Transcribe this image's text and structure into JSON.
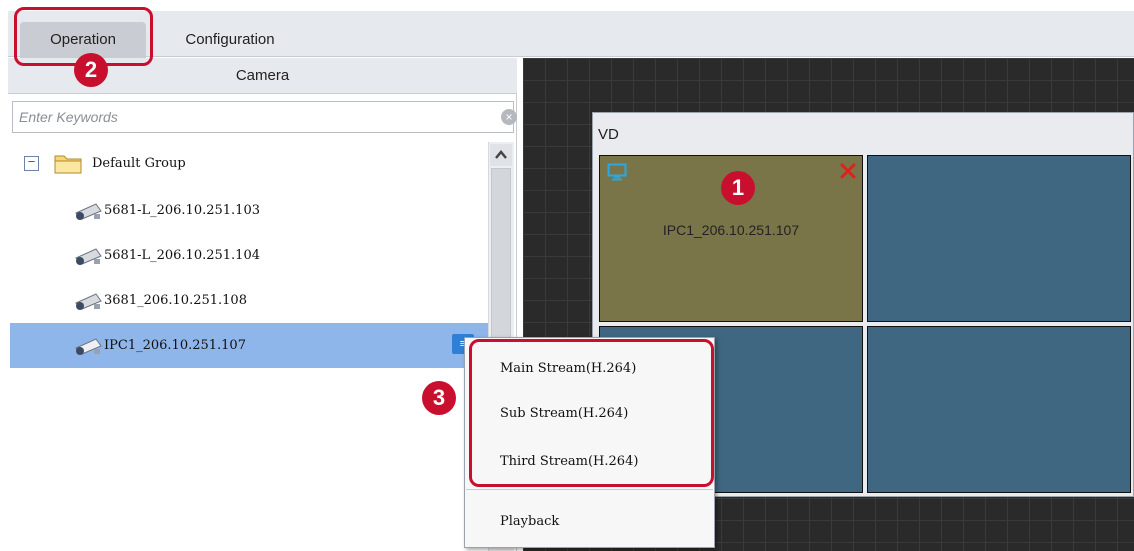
{
  "tabs": {
    "operation_label": "Operation",
    "configuration_label": "Configuration"
  },
  "camera_panel": {
    "header": "Camera",
    "search": {
      "placeholder": "Enter Keywords",
      "value": ""
    },
    "group": {
      "label": "Default Group",
      "expanded": true
    },
    "cameras": [
      {
        "label": "5681-L_206.10.251.103",
        "selected": false
      },
      {
        "label": "5681-L_206.10.251.104",
        "selected": false
      },
      {
        "label": "3681_206.10.251.108",
        "selected": false
      },
      {
        "label": "IPC1_206.10.251.107",
        "selected": true
      }
    ]
  },
  "video_wall": {
    "title": "VD",
    "pane_1_label": "IPC1_206.10.251.107"
  },
  "context_menu": {
    "items": [
      "Main Stream(H.264)",
      "Sub Stream(H.264)",
      "Third Stream(H.264)"
    ],
    "playback": "Playback"
  },
  "callouts": {
    "one": "1",
    "two": "2",
    "three": "3"
  },
  "colors": {
    "callout_red": "#c8102e",
    "selected_row": "#8fb6ea",
    "active_pane": "#7a7549",
    "pane": "#3f6782",
    "canvas": "#2a2a2a"
  },
  "icons": [
    "folder-icon",
    "camera-icon",
    "monitor-icon",
    "close-icon",
    "clear-icon",
    "scroll-up-icon",
    "list-menu-icon"
  ]
}
